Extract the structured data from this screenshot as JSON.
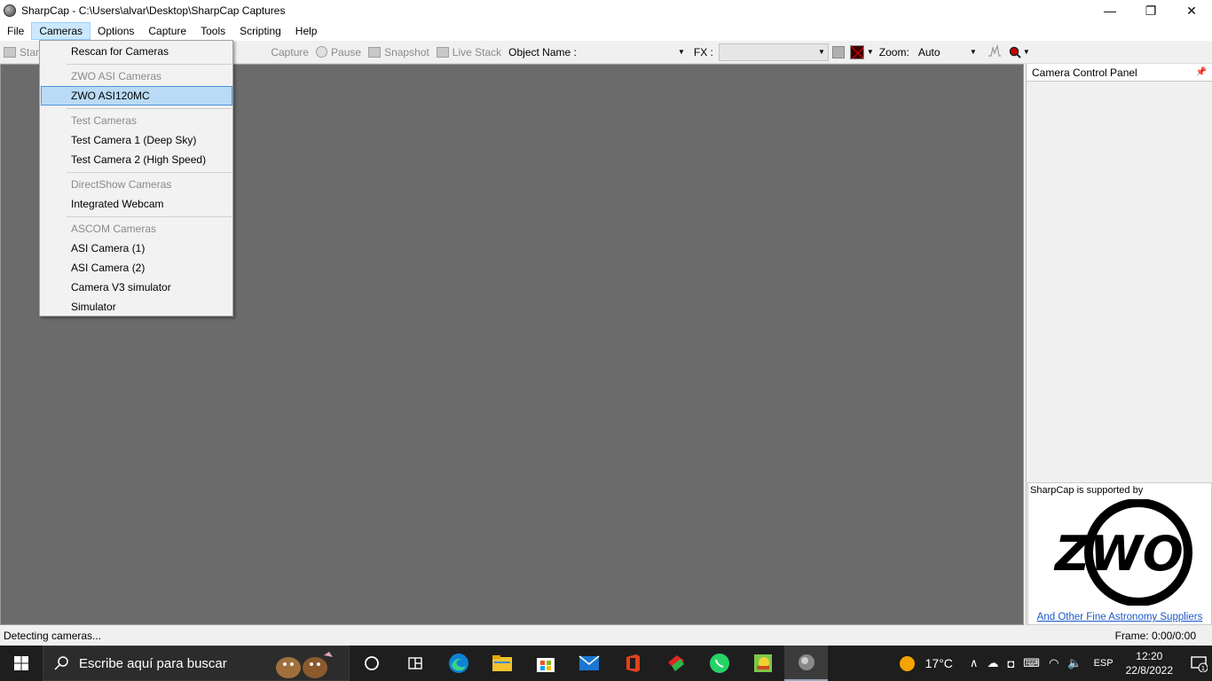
{
  "window": {
    "title": "SharpCap - C:\\Users\\alvar\\Desktop\\SharpCap Captures",
    "minimize": "—",
    "restore": "❐",
    "close": "✕"
  },
  "menubar": {
    "items": [
      "File",
      "Cameras",
      "Options",
      "Capture",
      "Tools",
      "Scripting",
      "Help"
    ],
    "active": "Cameras"
  },
  "toolbar": {
    "start": "Start",
    "capture": "Capture",
    "pause": "Pause",
    "snapshot": "Snapshot",
    "live_stack": "Live Stack",
    "object_name_label": "Object Name :",
    "object_name_value": "",
    "fx_label": "FX :",
    "fx_value": "",
    "zoom_label": "Zoom:",
    "zoom_value": "Auto"
  },
  "cameras_menu": {
    "rescan": "Rescan for Cameras",
    "zwo_header": "ZWO ASI Cameras",
    "zwo_item": "ZWO ASI120MC",
    "test_header": "Test Cameras",
    "test1": "Test Camera 1 (Deep Sky)",
    "test2": "Test Camera 2 (High Speed)",
    "directshow_header": "DirectShow Cameras",
    "webcam": "Integrated Webcam",
    "ascom_header": "ASCOM Cameras",
    "asi1": "ASI Camera (1)",
    "asi2": "ASI Camera (2)",
    "v3sim": "Camera V3 simulator",
    "sim": "Simulator"
  },
  "panel": {
    "title": "Camera Control Panel",
    "ad_text": "SharpCap is supported by",
    "logo_text": "ZWO",
    "ad_link": "And Other Fine Astronomy Suppliers"
  },
  "status": {
    "message": "Detecting cameras...",
    "frame": "Frame:  0:00/0:00"
  },
  "taskbar": {
    "search_placeholder": "Escribe aquí para buscar",
    "temperature": "17°C",
    "language": "ESP",
    "time": "12:20",
    "date": "22/8/2022",
    "notification_count": "1"
  },
  "colors": {
    "preview_bg": "#6b6b6b",
    "menu_highlight": "#b9dbf6",
    "taskbar_bg": "#1e1e1e",
    "link": "#1a57c9"
  }
}
